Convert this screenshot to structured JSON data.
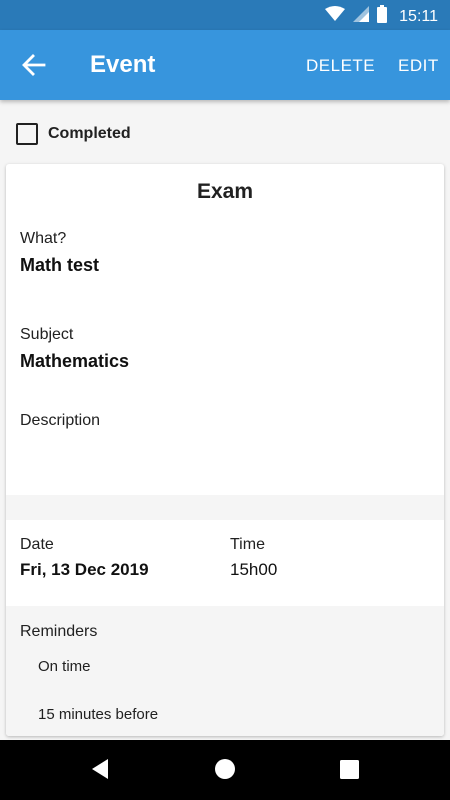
{
  "status_bar": {
    "time": "15:11",
    "icons": [
      "wifi-icon",
      "signal-icon",
      "battery-icon"
    ]
  },
  "app_bar": {
    "title": "Event",
    "back_icon": "back-arrow-icon",
    "actions": {
      "delete": "DELETE",
      "edit": "EDIT"
    }
  },
  "completed": {
    "label": "Completed",
    "checked": false
  },
  "event": {
    "type": "Exam",
    "what_label": "What?",
    "what_value": "Math test",
    "subject_label": "Subject",
    "subject_value": "Mathematics",
    "description_label": "Description",
    "description_value": "",
    "date_label": "Date",
    "date_value": "Fri, 13 Dec 2019",
    "time_label": "Time",
    "time_value": "15h00",
    "reminders_label": "Reminders",
    "reminders": [
      "On time",
      "15 minutes before"
    ]
  },
  "nav_bar": {
    "icons": [
      "back-triangle-icon",
      "home-circle-icon",
      "recents-square-icon"
    ]
  },
  "colors": {
    "status_bar": "#2a7ab8",
    "app_bar": "#3795dd",
    "background": "#f5f5f5",
    "card": "#ffffff"
  }
}
